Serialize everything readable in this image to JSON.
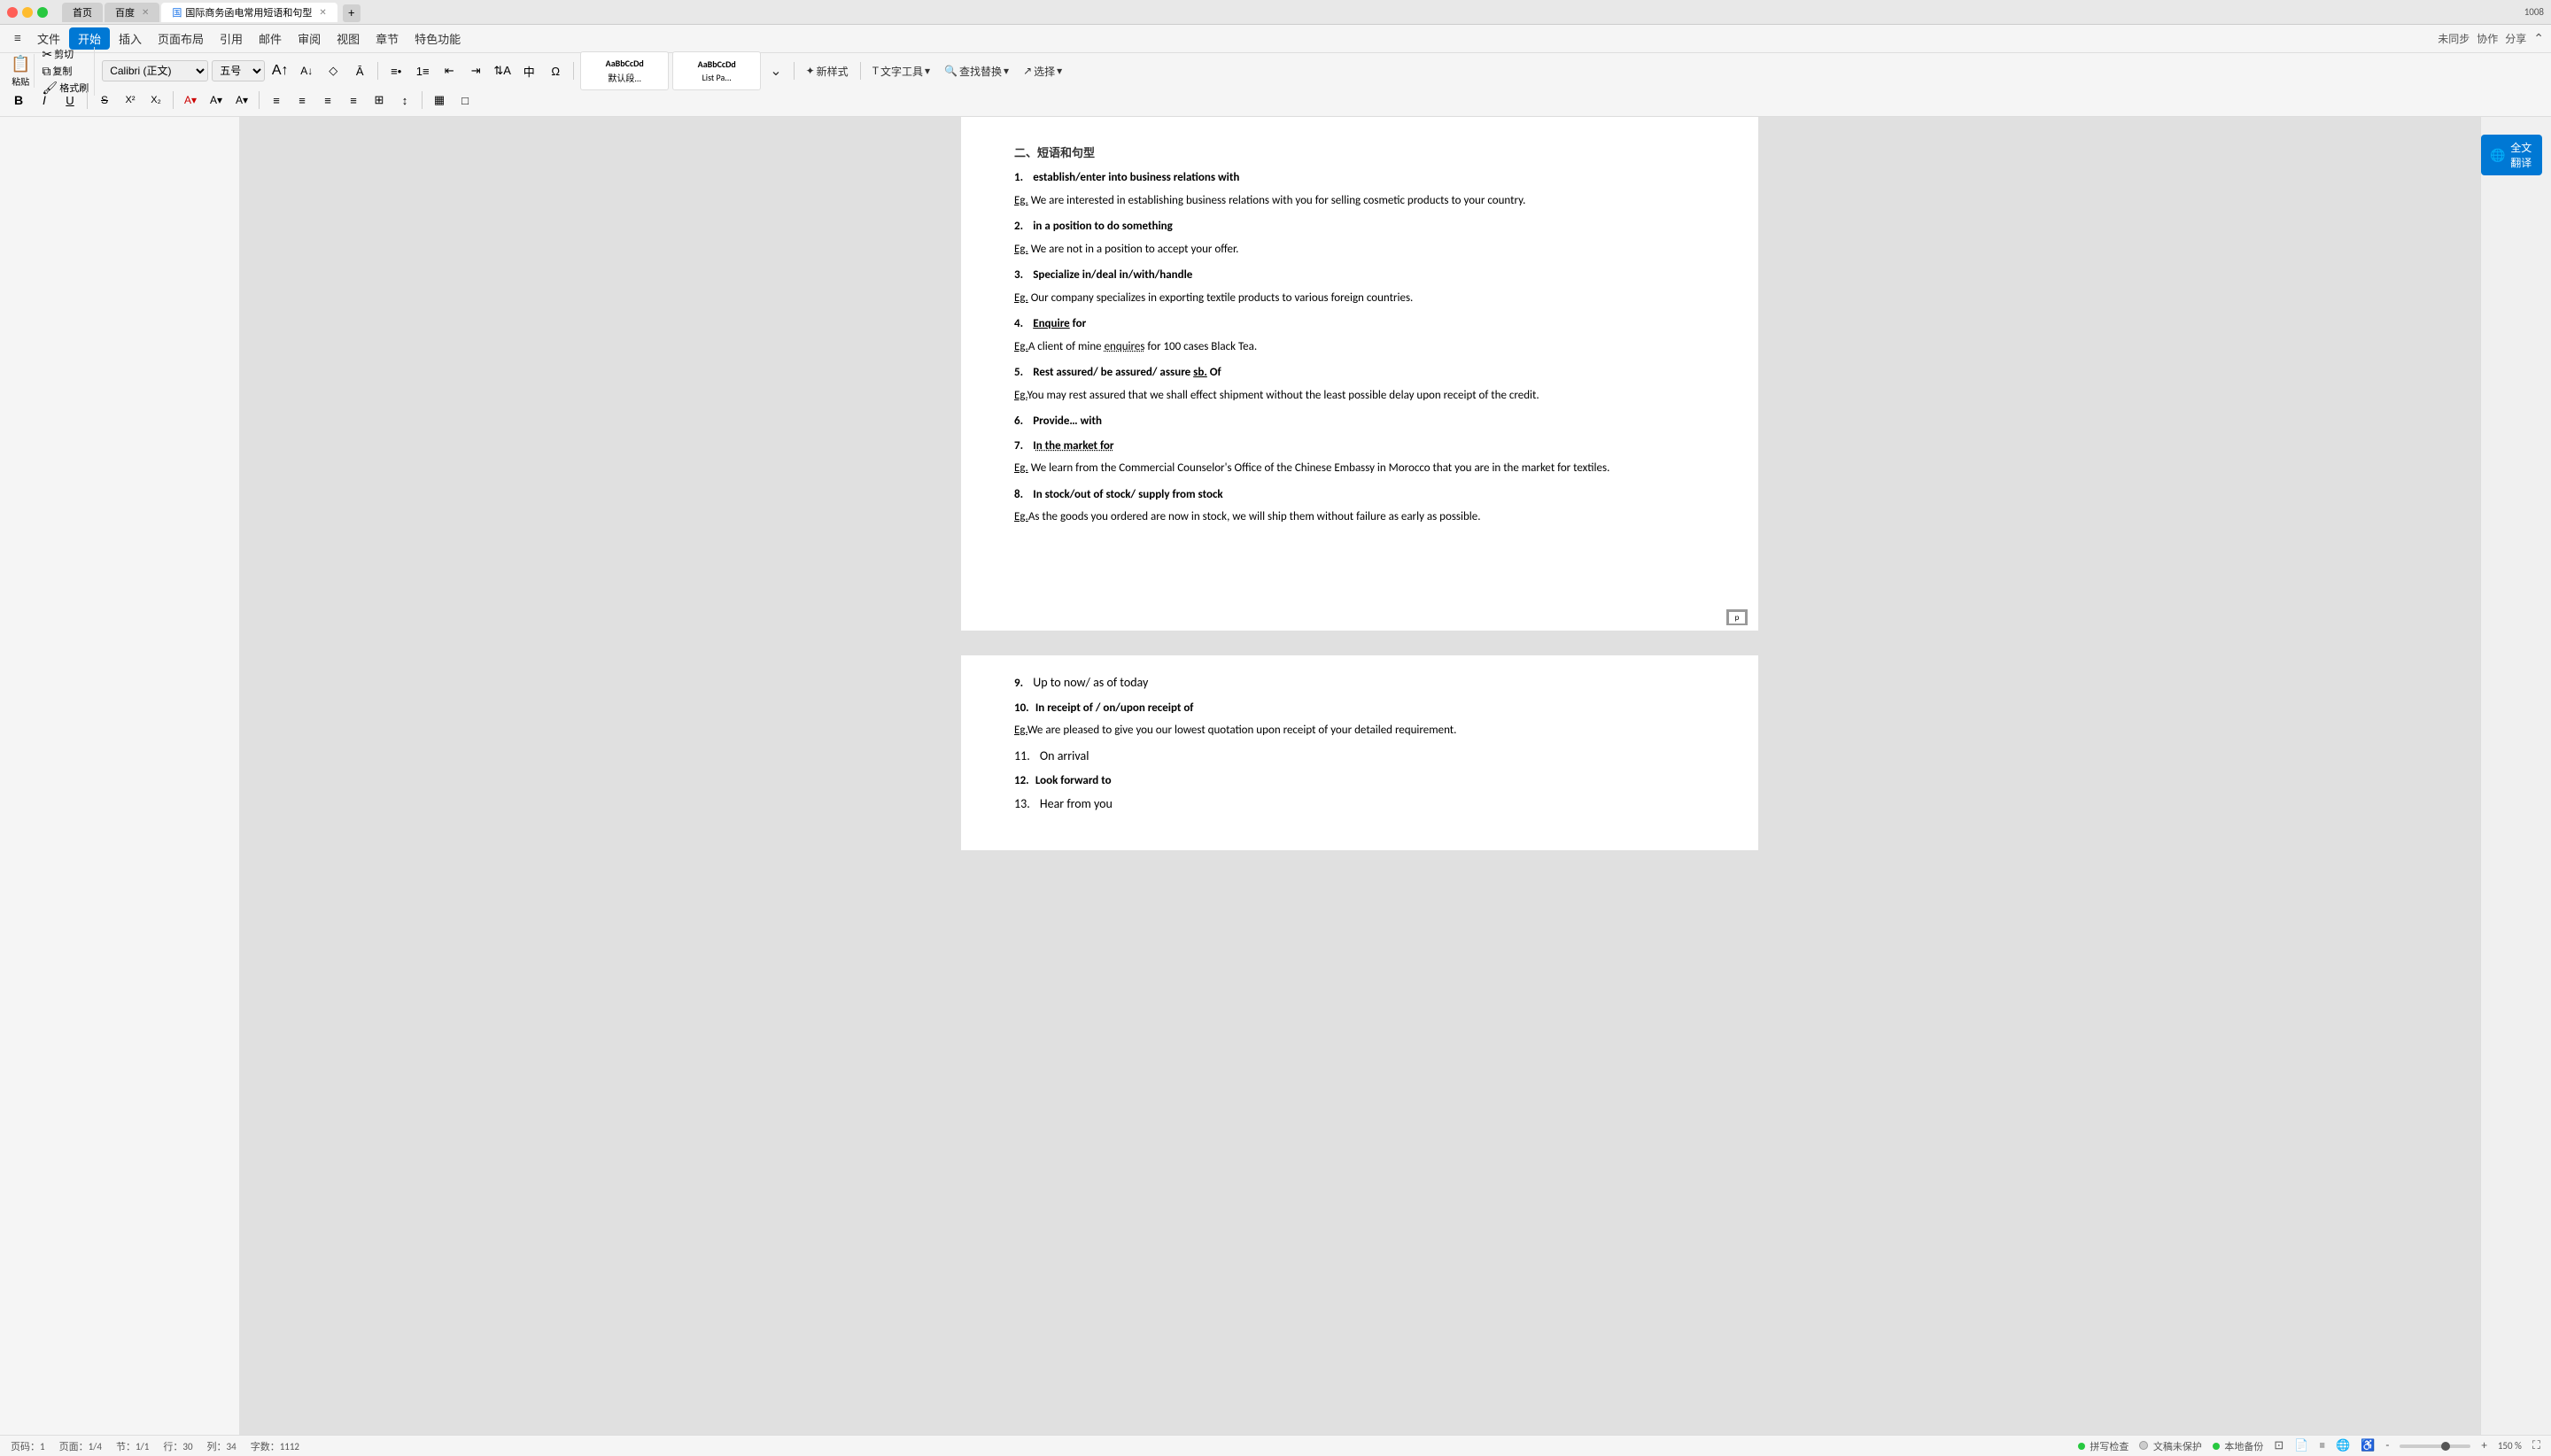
{
  "titlebar": {
    "tabs": [
      {
        "id": "home",
        "label": "首页",
        "active": false
      },
      {
        "id": "baidu",
        "label": "百度",
        "active": false
      },
      {
        "id": "doc",
        "label": "国际商务函电常用短语和句型",
        "active": true
      }
    ],
    "add_tab": "+",
    "right_text": "1008"
  },
  "menubar": {
    "items": [
      {
        "id": "hamburger",
        "label": "≡"
      },
      {
        "id": "file",
        "label": "文件"
      },
      {
        "id": "kaishi",
        "label": "开始",
        "active": true
      },
      {
        "id": "charu",
        "label": "插入"
      },
      {
        "id": "layout",
        "label": "页面布局"
      },
      {
        "id": "yinyong",
        "label": "引用"
      },
      {
        "id": "youjian",
        "label": "邮件"
      },
      {
        "id": "shending",
        "label": "审阅"
      },
      {
        "id": "shitu",
        "label": "视图"
      },
      {
        "id": "zhangji",
        "label": "章节"
      },
      {
        "id": "tese",
        "label": "特色功能"
      }
    ],
    "right": {
      "sync": "未同步",
      "collab": "协作",
      "share": "分享"
    }
  },
  "toolbar": {
    "font_name": "Calibri (正文)",
    "font_size": "五号",
    "paste_label": "粘贴",
    "cut_label": "剪切",
    "copy_label": "复制",
    "format_label": "格式刷",
    "bold": "B",
    "italic": "I",
    "underline": "U",
    "styles": [
      {
        "id": "default",
        "preview": "AaBbCcDd",
        "label": "默认段..."
      },
      {
        "id": "listpa",
        "preview": "AaBbCcDd",
        "label": "List Pa..."
      }
    ],
    "new_style": "新样式",
    "text_tool": "文字工具",
    "find_replace": "查找替换",
    "select": "选择"
  },
  "document": {
    "section_title": "二、短语和句型",
    "items_page1": [
      {
        "num": "1.",
        "label": "establish/enter into business relations with",
        "eg_label": "Eg.",
        "eg_text": " We are interested in establishing business relations with you for selling cosmetic products to your country."
      },
      {
        "num": "2.",
        "label": "in a position to do something",
        "eg_label": "Eg.",
        "eg_text": " We are not in a position to accept your offer."
      },
      {
        "num": "3.",
        "label": "Specialize in/deal in/with/handle",
        "eg_label": "Eg.",
        "eg_text": " Our company specializes in exporting textile products to various foreign countries."
      },
      {
        "num": "4.",
        "label": "Enquire for",
        "eg_label": "Eg.",
        "eg_text": "A client of mine enquires for 100 cases Black Tea."
      },
      {
        "num": "5.",
        "label": "Rest assured/ be assured/ assure sb. Of",
        "eg_label": "Eg.",
        "eg_text": "You may rest assured that we shall effect shipment without the least possible delay upon receipt of the credit."
      },
      {
        "num": "6.",
        "label": "Provide… with",
        "eg_label": null,
        "eg_text": null
      },
      {
        "num": "7.",
        "label": "In the market for",
        "eg_label": "Eg.",
        "eg_text": " We learn from the Commercial Counselor's Office of the Chinese Embassy in Morocco that you are in the market for textiles."
      },
      {
        "num": "8.",
        "label": "In stock/out of stock/ supply from stock",
        "eg_label": "Eg.",
        "eg_text": "As the goods you ordered are now in stock, we will ship them without failure as early as possible."
      }
    ],
    "items_page2": [
      {
        "num": "9.",
        "label": "Up to now/ as of today",
        "eg_label": null,
        "eg_text": null
      },
      {
        "num": "10.",
        "label": "In receipt of / on/upon receipt of",
        "eg_label": "Eg.",
        "eg_text": "We are pleased to give you our lowest quotation upon receipt of your detailed requirement."
      },
      {
        "num": "11.",
        "label": "On arrival",
        "eg_label": null,
        "eg_text": null
      },
      {
        "num": "12.",
        "label": "Look forward to",
        "eg_label": null,
        "eg_text": null
      },
      {
        "num": "13.",
        "label": "Hear from you",
        "eg_label": null,
        "eg_text": null
      }
    ]
  },
  "right_panel": {
    "translate_label": "全文翻译",
    "upload_icon": "⬆"
  },
  "statusbar": {
    "page_num": "页码：1",
    "pages": "页面：1/4",
    "section": "节：1/1",
    "line": "行：30",
    "col": "列：34",
    "words": "字数：1112",
    "spell_check": "拼写检查",
    "file_status": "文稿未保护",
    "backup": "本地备份",
    "zoom_percent": "150 %"
  }
}
